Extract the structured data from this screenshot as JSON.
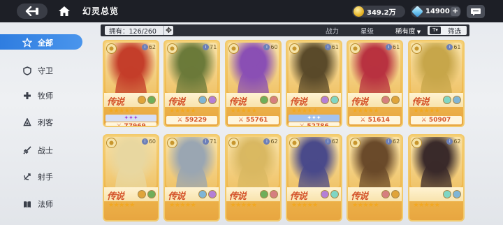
{
  "header": {
    "title": "幻灵总览",
    "gold": "349.2万",
    "gems": "14900",
    "plus": "+"
  },
  "filter": {
    "owned": "拥有：126/260",
    "sort_power": "战力",
    "sort_level": "星级",
    "sort_rarity": "稀有度",
    "filter_label": "筛选"
  },
  "sidebar": {
    "items": [
      {
        "label": "全部",
        "icon": "star-icon",
        "active": true
      },
      {
        "label": "守卫",
        "icon": "shield-icon"
      },
      {
        "label": "牧师",
        "icon": "cross-icon"
      },
      {
        "label": "刺客",
        "icon": "dagger-icon"
      },
      {
        "label": "战士",
        "icon": "sword-icon"
      },
      {
        "label": "射手",
        "icon": "bow-icon"
      },
      {
        "label": "法师",
        "icon": "book-icon"
      }
    ]
  },
  "cards": [
    {
      "level": "62",
      "rarity": "传说",
      "stars": "★★★★★",
      "awaken": "✦✦✦",
      "power": "⚔ 77969",
      "color": "#c43e2a"
    },
    {
      "level": "71",
      "rarity": "传说",
      "stars": "★★★★★",
      "awaken": "",
      "power": "⚔ 59229",
      "color": "#6b7a3a"
    },
    {
      "level": "60",
      "rarity": "传说",
      "stars": "★★★★★",
      "awaken": "",
      "power": "⚔ 55761",
      "color": "#8a4fb4"
    },
    {
      "level": "61",
      "rarity": "传说",
      "stars": "★★★★★",
      "awaken": "✦✦✦",
      "power": "⚔ 52786",
      "color": "#5a4a2a"
    },
    {
      "level": "61",
      "rarity": "传说",
      "stars": "★★★★★",
      "awaken": "",
      "power": "⚔ 51614",
      "color": "#b83240"
    },
    {
      "level": "61",
      "rarity": "传说",
      "stars": "★★★★★",
      "awaken": "",
      "power": "⚔ 50907",
      "color": "#c7a64a"
    },
    {
      "level": "60",
      "rarity": "传说",
      "stars": "★★★★★",
      "awaken": "",
      "power": "",
      "color": "#e8d7a0"
    },
    {
      "level": "71",
      "rarity": "传说",
      "stars": "★★★★★",
      "awaken": "",
      "power": "",
      "color": "#9aa6b2"
    },
    {
      "level": "62",
      "rarity": "传说",
      "stars": "★★★★★",
      "awaken": "",
      "power": "",
      "color": "#d9b862"
    },
    {
      "level": "62",
      "rarity": "传说",
      "stars": "★★★★★",
      "awaken": "",
      "power": "",
      "color": "#4a4a8a"
    },
    {
      "level": "62",
      "rarity": "传说",
      "stars": "★★★★★",
      "awaken": "",
      "power": "",
      "color": "#6a4a2a"
    },
    {
      "level": "62",
      "rarity": "",
      "stars": "★★★★★",
      "awaken": "",
      "power": "",
      "color": "#3a2a2a"
    }
  ]
}
